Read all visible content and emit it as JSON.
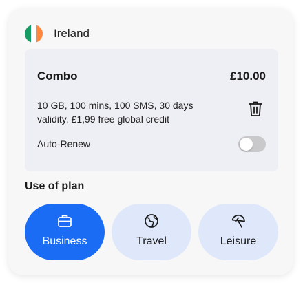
{
  "country": {
    "name": "Ireland",
    "flag_colors": [
      "#169b62",
      "#ffffff",
      "#ff883e"
    ]
  },
  "plan": {
    "name": "Combo",
    "price": "£10.00",
    "description": "10 GB, 100 mins, 100 SMS, 30 days validity, £1,99 free global credit",
    "delete_icon": "trash-icon",
    "auto_renew": {
      "label": "Auto-Renew",
      "enabled": false
    }
  },
  "use_of_plan": {
    "title": "Use of plan",
    "selected": "Business",
    "options": [
      {
        "label": "Business",
        "icon": "briefcase-icon"
      },
      {
        "label": "Travel",
        "icon": "globe-icon"
      },
      {
        "label": "Leisure",
        "icon": "umbrella-icon"
      }
    ]
  },
  "colors": {
    "accent": "#1a6cf5",
    "option_bg": "#dfe8fb",
    "plan_bg": "#eeeff4"
  }
}
